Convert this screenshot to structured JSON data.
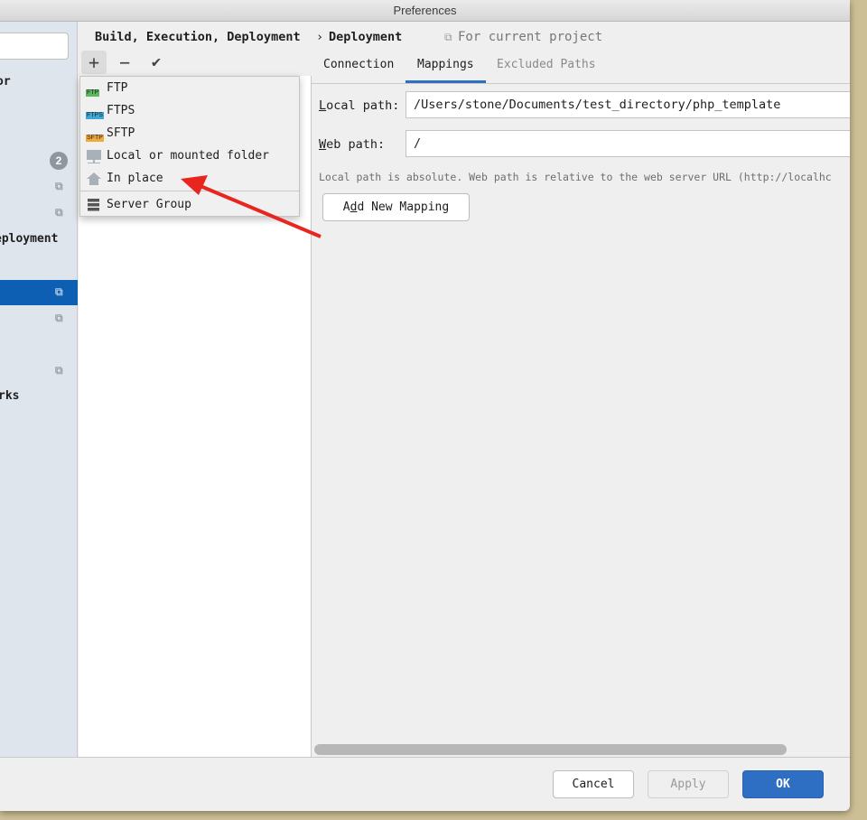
{
  "window": {
    "title": "Preferences"
  },
  "sidebar": {
    "items": [
      {
        "label": "or",
        "kind": "text"
      },
      {
        "badge": "2"
      },
      {
        "icon": "copy-icon"
      },
      {
        "icon": "copy-icon"
      },
      {
        "label": "eployment"
      },
      {
        "icon": "copy-icon",
        "selected": true
      },
      {
        "icon": "copy-icon"
      },
      {
        "icon": "copy-icon"
      },
      {
        "label": "rks"
      }
    ]
  },
  "breadcrumb": {
    "parent": "Build, Execution, Deployment",
    "separator": "›",
    "current": "Deployment",
    "scope": "For current project"
  },
  "toolbar": {
    "add": "+",
    "remove": "−",
    "check": "✔"
  },
  "add_menu": {
    "items": [
      {
        "label": "FTP",
        "icon": "ftp-icon",
        "tag": "FTP",
        "color": "#5cb85c"
      },
      {
        "label": "FTPS",
        "icon": "ftps-icon",
        "tag": "FTPS",
        "color": "#3ea6d6"
      },
      {
        "label": "SFTP",
        "icon": "sftp-icon",
        "tag": "SFTP",
        "color": "#f0a93c"
      },
      {
        "label": "Local or mounted folder",
        "icon": "folder-icon"
      },
      {
        "label": "In place",
        "icon": "home-icon"
      },
      {
        "label": "Server Group",
        "icon": "server-group-icon"
      }
    ]
  },
  "tabs": [
    {
      "label": "Connection"
    },
    {
      "label": "Mappings",
      "active": true
    },
    {
      "label": "Excluded Paths",
      "disabled": true
    }
  ],
  "mappings": {
    "local_path_label_key": "L",
    "local_path_label_rest": "ocal path:",
    "local_path": "/Users/stone/Documents/test_directory/php_template",
    "web_path_label_key": "W",
    "web_path_label_rest": "eb path:",
    "web_path": "/",
    "hint": "Local path is absolute. Web path is relative to the web server URL (http://localhc",
    "add_btn_pre": "A",
    "add_btn_key": "d",
    "add_btn_post": "d New Mapping"
  },
  "footer": {
    "cancel": "Cancel",
    "apply": "Apply",
    "ok": "OK"
  },
  "colors": {
    "accent": "#2e6fc4",
    "selection": "#0d5fb4",
    "arrow": "#e8261f"
  }
}
